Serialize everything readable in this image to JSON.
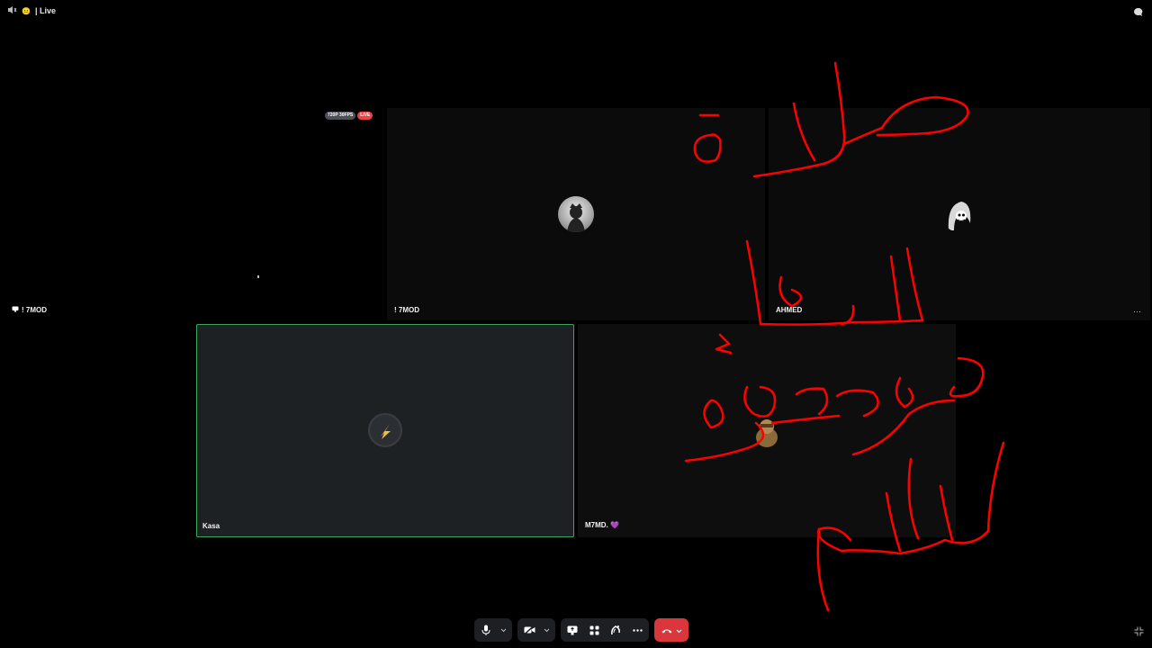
{
  "window": {
    "title": "| Live",
    "emoji": "😐"
  },
  "stream": {
    "quality": "720P 30FPS",
    "live": "LIVE"
  },
  "tiles": [
    {
      "name": "! 7MOD",
      "type": "screen-share"
    },
    {
      "name": "! 7MOD",
      "type": "camera-off"
    },
    {
      "name": "AHMED",
      "type": "camera-off"
    },
    {
      "name": "Kasa",
      "type": "camera-off",
      "speaking": true
    },
    {
      "name": "M7MD. 💜",
      "type": "camera-off"
    }
  ],
  "controls": [
    "microphone",
    "camera",
    "screen-share",
    "activities",
    "soundboard",
    "more",
    "disconnect"
  ],
  "colors": {
    "speaking": "#3ba55c",
    "live": "#ed4245",
    "hangup": "#da373c",
    "annotation": "#ff0000"
  }
}
